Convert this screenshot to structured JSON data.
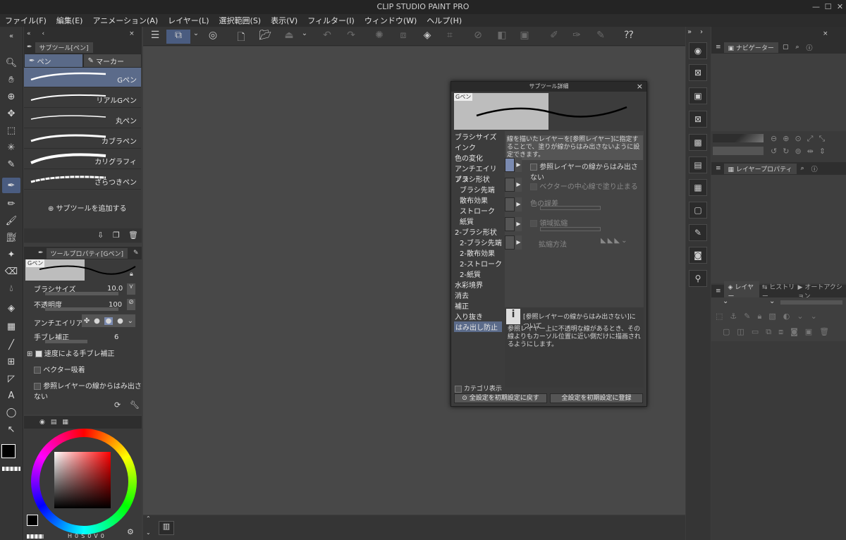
{
  "app": {
    "title": "CLIP STUDIO PAINT PRO"
  },
  "window_controls": {
    "minimize": "—",
    "maximize": "☐",
    "close": "✕"
  },
  "menu": [
    "ファイル(F)",
    "編集(E)",
    "アニメーション(A)",
    "レイヤー(L)",
    "選択範囲(S)",
    "表示(V)",
    "フィルター(I)",
    "ウィンドウ(W)",
    "ヘルプ(H)"
  ],
  "subtool_panel": {
    "title": "サブツール[ペン]",
    "tabs": [
      "ペン",
      "マーカー"
    ],
    "brushes": [
      "Gペン",
      "リアルGペン",
      "丸ペン",
      "カブラペン",
      "カリグラフィ",
      "ざらつきペン"
    ],
    "add_label": "サブツールを追加する"
  },
  "tool_property": {
    "title": "ツールプロパティ[Gペン]",
    "brush_name": "Gペン",
    "brush_size_label": "ブラシサイズ",
    "brush_size_value": "10.0",
    "opacity_label": "不透明度",
    "opacity_value": "100",
    "antialias_label": "アンチエイリアス",
    "stabilization_label": "手ブレ補正",
    "stabilization_value": "6",
    "speed_label": "速度による手ブレ補正",
    "vector_snap_label": "ベクター吸着",
    "ref_layer_label": "参照レイヤーの線からはみ出さない"
  },
  "color": {
    "fg": "#000000",
    "bg": "#ffffff",
    "hsv_labels": [
      "H",
      "0",
      "S",
      "0",
      "V",
      "0"
    ]
  },
  "navigator": {
    "title": "ナビゲーター"
  },
  "layer_property": {
    "title": "レイヤープロパティ"
  },
  "layer_panel": {
    "tabs": [
      "レイヤー",
      "ヒストリー",
      "オートアクション"
    ]
  },
  "dialog": {
    "title": "サブツール詳細",
    "brush_name": "Gペン",
    "categories": [
      {
        "label": "ブラシサイズ",
        "indent": false
      },
      {
        "label": "インク",
        "indent": false
      },
      {
        "label": "色の変化",
        "indent": false
      },
      {
        "label": "アンチエイリアス",
        "indent": false
      },
      {
        "label": "ブラシ形状",
        "indent": false
      },
      {
        "label": "ブラシ先端",
        "indent": true
      },
      {
        "label": "散布効果",
        "indent": true
      },
      {
        "label": "ストローク",
        "indent": true
      },
      {
        "label": "紙質",
        "indent": true
      },
      {
        "label": "2-ブラシ形状",
        "indent": false
      },
      {
        "label": "2-ブラシ先端",
        "indent": true
      },
      {
        "label": "2-散布効果",
        "indent": true
      },
      {
        "label": "2-ストローク",
        "indent": true
      },
      {
        "label": "2-紙質",
        "indent": true
      },
      {
        "label": "水彩境界",
        "indent": false
      },
      {
        "label": "消去",
        "indent": false
      },
      {
        "label": "補正",
        "indent": false
      },
      {
        "label": "入り抜き",
        "indent": false
      },
      {
        "label": "はみ出し防止",
        "indent": false
      }
    ],
    "description": "線を描いたレイヤーを[参照レイヤー]に指定することで、塗りが線からはみ出さないように設定できます。",
    "option1": "参照レイヤーの線からはみ出さない",
    "option2": "ベクターの中心線で塗り止まる",
    "option3": "色の誤差",
    "option4": "領域拡縮",
    "option5": "拡縮方法",
    "info_title": "[参照レイヤーの線からはみ出さない]について",
    "info_text": "参照レイヤー上に不透明な線があるとき、その線よりもカーソル位置に近い側だけに描画されるようにします。",
    "category_display": "カテゴリ表示",
    "reset_button": "全設定を初期設定に戻す",
    "register_button": "全設定を初期設定に登録"
  }
}
